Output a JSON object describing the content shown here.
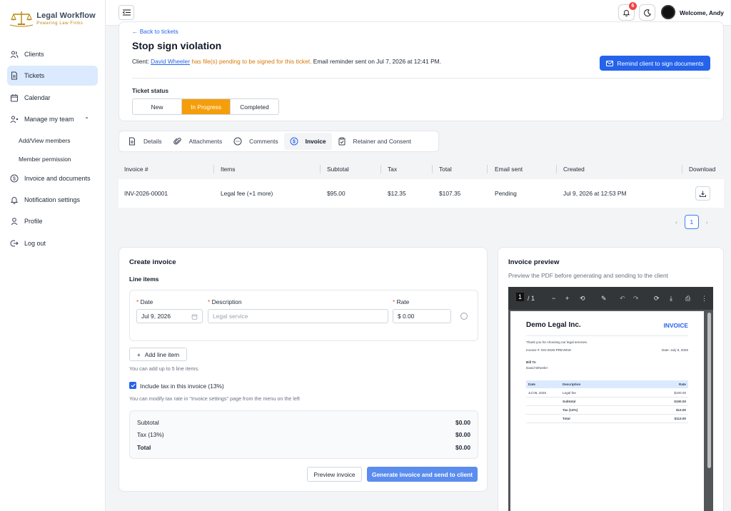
{
  "brand": {
    "title": "Legal Workflow",
    "subtitle": "Powering Law Firms",
    "accent": "#2563eb",
    "gold": "#b8860b"
  },
  "sidebar": {
    "items": [
      {
        "label": "Clients",
        "icon": "users-icon"
      },
      {
        "label": "Tickets",
        "icon": "document-icon",
        "active": true
      },
      {
        "label": "Calendar",
        "icon": "calendar-icon"
      },
      {
        "label": "Manage my team",
        "icon": "team-icon",
        "expanded": true
      },
      {
        "label": "Add/View members"
      },
      {
        "label": "Member permission"
      },
      {
        "label": "Invoice and documents",
        "icon": "dollar-icon"
      },
      {
        "label": "Notification settings",
        "icon": "bell-icon"
      },
      {
        "label": "Profile",
        "icon": "user-icon"
      },
      {
        "label": "Log out",
        "icon": "logout-icon"
      }
    ]
  },
  "header": {
    "notification_count": "6",
    "welcome": "Welcome, Andy"
  },
  "ticket": {
    "back_link": "← Back to tickets",
    "title": "Stop sign violation",
    "client_prefix": "Client:",
    "client_name": "David Wheeler",
    "pending_text": "has file(s) pending to be signed for this ticket.",
    "reminder_text": "Email reminder sent on Jul 7, 2026 at 12:41 PM.",
    "remind_button": "Remind client to sign documents",
    "status_label": "Ticket status",
    "status_options": [
      "New",
      "In Progress",
      "Completed"
    ],
    "status_selected": "In Progress"
  },
  "tabs": [
    {
      "label": "Details",
      "icon": "file-icon"
    },
    {
      "label": "Attachments",
      "icon": "paperclip-icon"
    },
    {
      "label": "Comments",
      "icon": "chat-icon"
    },
    {
      "label": "Invoice",
      "icon": "dollar-circle-icon",
      "active": true
    },
    {
      "label": "Retainer and Consent",
      "icon": "clipboard-icon"
    }
  ],
  "invoice_table": {
    "headers": [
      "Invoice #",
      "Items",
      "Subtotal",
      "Tax",
      "Total",
      "Email sent",
      "Created",
      "Download"
    ],
    "rows": [
      {
        "invoice_no": "INV-2026-00001",
        "items": "Legal fee (+1 more)",
        "subtotal": "$95.00",
        "tax": "$12.35",
        "total": "$107.35",
        "email_sent": "Pending",
        "created": "Jul 9, 2026 at 12:53 PM"
      }
    ],
    "pager": {
      "prev": "‹",
      "current": "1",
      "next": "›"
    }
  },
  "create_invoice": {
    "title": "Create invoice",
    "line_items_title": "Line items",
    "date_label": "Date",
    "description_label": "Description",
    "rate_label": "Rate",
    "date_value": "Jul 9, 2026",
    "description_placeholder": "Legal service",
    "rate_value": "$ 0.00",
    "add_line_button": "Add line item",
    "add_line_hint": "You can add up to 5 line items.",
    "include_tax_label": "Include tax in this invoice (13%)",
    "tax_hint": "You can modify tax rate in \"Invoice settings\" page from the menu on the left",
    "subtotal_label": "Subtotal",
    "subtotal_value": "$0.00",
    "tax_label": "Tax (13%)",
    "tax_value": "$0.00",
    "total_label": "Total",
    "total_value": "$0.00",
    "preview_button": "Preview invoice",
    "generate_button": "Generate invoice and send to client"
  },
  "preview": {
    "title": "Invoice preview",
    "subtitle": "Preview the PDF before generating and sending to the client",
    "toolbar": {
      "page_current": "1",
      "page_total": "/ 1"
    },
    "pdf": {
      "company": "Demo Legal Inc.",
      "heading": "INVOICE",
      "thanks": "Thank you for choosing our legal services.",
      "invoice_no": "Invoice #: INV-2026-PREVIEW",
      "date": "Date: July 9, 2026",
      "bill_to": "Bill To",
      "client": "David Wheeler",
      "col_date": "Date",
      "col_desc": "Description",
      "col_rate": "Rate",
      "row_date": "Jul 08, 2026",
      "row_desc": "Legal fee",
      "row_rate": "$100.00",
      "subtotal_label": "Subtotal",
      "subtotal_value": "$100.00",
      "tax_label": "Tax (13%)",
      "tax_value": "$13.00",
      "total_label": "Total",
      "total_value": "$113.00"
    }
  }
}
